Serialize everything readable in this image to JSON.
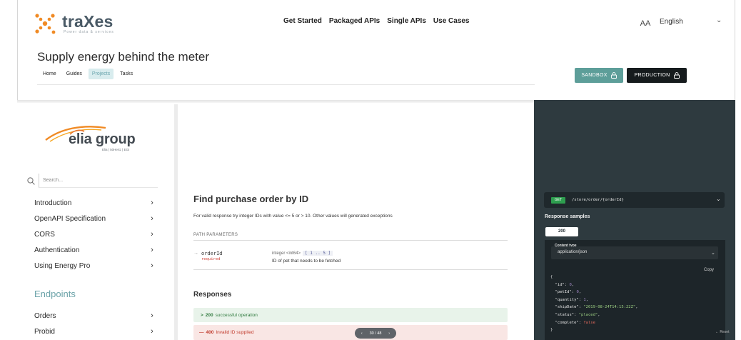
{
  "brand": {
    "name": "traXes",
    "tagline": "Power data & services"
  },
  "top_nav": [
    "Get Started",
    "Packaged APIs",
    "Single APIs",
    "Use Cases"
  ],
  "user": {
    "initials": "AA",
    "language": "English"
  },
  "page": {
    "title": "Supply energy behind the meter",
    "tabs": [
      "Home",
      "Guides",
      "Projects",
      "Tasks"
    ],
    "active_tab": "Projects"
  },
  "env_buttons": {
    "sandbox": "SANDBOX",
    "production": "PRODUCTION"
  },
  "sidebar": {
    "org_name": "elia group",
    "org_sub": "Elia | 50Hertz | EGI",
    "search_placeholder": "Search...",
    "items": [
      {
        "label": "Introduction"
      },
      {
        "label": "OpenAPI Specification"
      },
      {
        "label": "CORS"
      },
      {
        "label": "Authentication"
      },
      {
        "label": "Using Energy Pro"
      }
    ],
    "endpoints_heading": "Endpoints",
    "endpoint_items": [
      {
        "label": "Orders"
      },
      {
        "label": "Probid"
      }
    ]
  },
  "operation": {
    "title": "Find purchase order by ID",
    "description": "For valid response try integer IDs with value <= 5 or > 10. Other values will generated exceptions",
    "path_params_label": "PATH PARAMETERS",
    "param": {
      "name": "orderId",
      "required": "required",
      "type": "integer <int64>",
      "range": "[ 1 .. 5 ]",
      "description": "ID of pet that needs to be fetched"
    },
    "responses_title": "Responses",
    "responses": [
      {
        "code": "200",
        "text": "successful operation",
        "prefix": ">"
      },
      {
        "code": "400",
        "text": "Invalid ID supplied",
        "prefix": "—"
      }
    ]
  },
  "pager": {
    "label": "30 / 48"
  },
  "right_panel": {
    "method": "GET",
    "path": "/store/order/{orderId}",
    "samples_title": "Response samples",
    "status_tab": "200",
    "content_type_label": "Content type",
    "content_type": "application/json",
    "copy_label": "Copy",
    "reset_hint": "Reset",
    "json_sample": {
      "id": "0",
      "petId": "0",
      "quantity": "1",
      "shipDate": "\"2019-08-24T14:15:22Z\"",
      "status": "\"placed\"",
      "complete": "false"
    }
  },
  "colors": {
    "accent_teal": "#5d9e99",
    "dark_panel": "#2e3a3f",
    "production_btn": "#161b1d",
    "logo_orange": "#f08a24"
  }
}
